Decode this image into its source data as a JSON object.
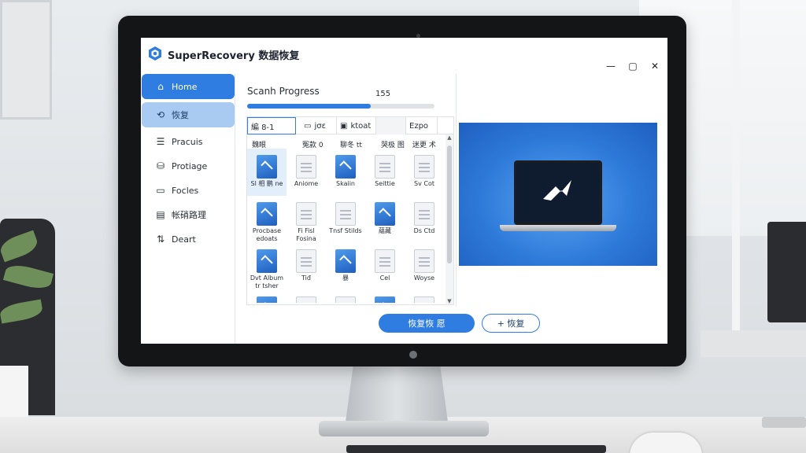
{
  "app": {
    "title": "SuperRecovery 数据恢复",
    "window_controls": {
      "minimize": "—",
      "maximize": "▢",
      "close": "✕"
    }
  },
  "sidebar": {
    "items": [
      {
        "label": "Home",
        "icon": "home-icon",
        "state": "active"
      },
      {
        "label": "恢复",
        "icon": "recover-icon",
        "state": "selected"
      },
      {
        "label": "Pracuis",
        "icon": "list-icon",
        "state": "normal"
      },
      {
        "label": "Protiage",
        "icon": "storage-icon",
        "state": "normal"
      },
      {
        "label": "Focles",
        "icon": "folder-icon",
        "state": "normal"
      },
      {
        "label": "帐硝路理",
        "icon": "manage-icon",
        "state": "normal"
      },
      {
        "label": "Deart",
        "icon": "sort-icon",
        "state": "normal"
      }
    ]
  },
  "scan": {
    "label": "Scanh Progress",
    "count": "155",
    "progress": 0.66
  },
  "files": {
    "tabs": [
      {
        "label": "編 8-1",
        "icon": ""
      },
      {
        "label": "jσε",
        "icon": "file-icon"
      },
      {
        "label": "ktoat",
        "icon": "image-icon"
      },
      {
        "label": ""
      },
      {
        "label": "Ezpo",
        "icon": ""
      }
    ],
    "columns": [
      "魏眼",
      "冤款 0",
      "聊冬 tt",
      "哭极 图",
      "迷更 术"
    ],
    "items": [
      {
        "label": "Sl 相 鹏 ne",
        "kind": "blue",
        "selected": true
      },
      {
        "label": "Aniome",
        "kind": "doc"
      },
      {
        "label": "Skaiin",
        "kind": "blue"
      },
      {
        "label": "Seittie",
        "kind": "doc"
      },
      {
        "label": "Sv Cot",
        "kind": "doc"
      },
      {
        "label": "Procbase edoats",
        "kind": "blue"
      },
      {
        "label": "Fi  Fisl Fosina",
        "kind": "doc"
      },
      {
        "label": "Tnsf Stilds",
        "kind": "doc"
      },
      {
        "label": "蘊藏",
        "kind": "blue"
      },
      {
        "label": "Ds Ctd",
        "kind": "doc"
      },
      {
        "label": "Dvt Album tr tsher",
        "kind": "blue"
      },
      {
        "label": "Tiđ",
        "kind": "doc"
      },
      {
        "label": "暴",
        "kind": "blue"
      },
      {
        "label": "Cel",
        "kind": "doc"
      },
      {
        "label": "Woyse",
        "kind": "doc"
      },
      {
        "label": "",
        "kind": "blue"
      },
      {
        "label": "",
        "kind": "doc"
      },
      {
        "label": "",
        "kind": "doc"
      },
      {
        "label": "",
        "kind": "blue"
      },
      {
        "label": "",
        "kind": "doc"
      }
    ]
  },
  "buttons": {
    "recover": "恢复恢 愿",
    "secondary": "+ 恢复"
  },
  "colors": {
    "accent": "#2f7de0",
    "selected": "#a9cbf2"
  }
}
